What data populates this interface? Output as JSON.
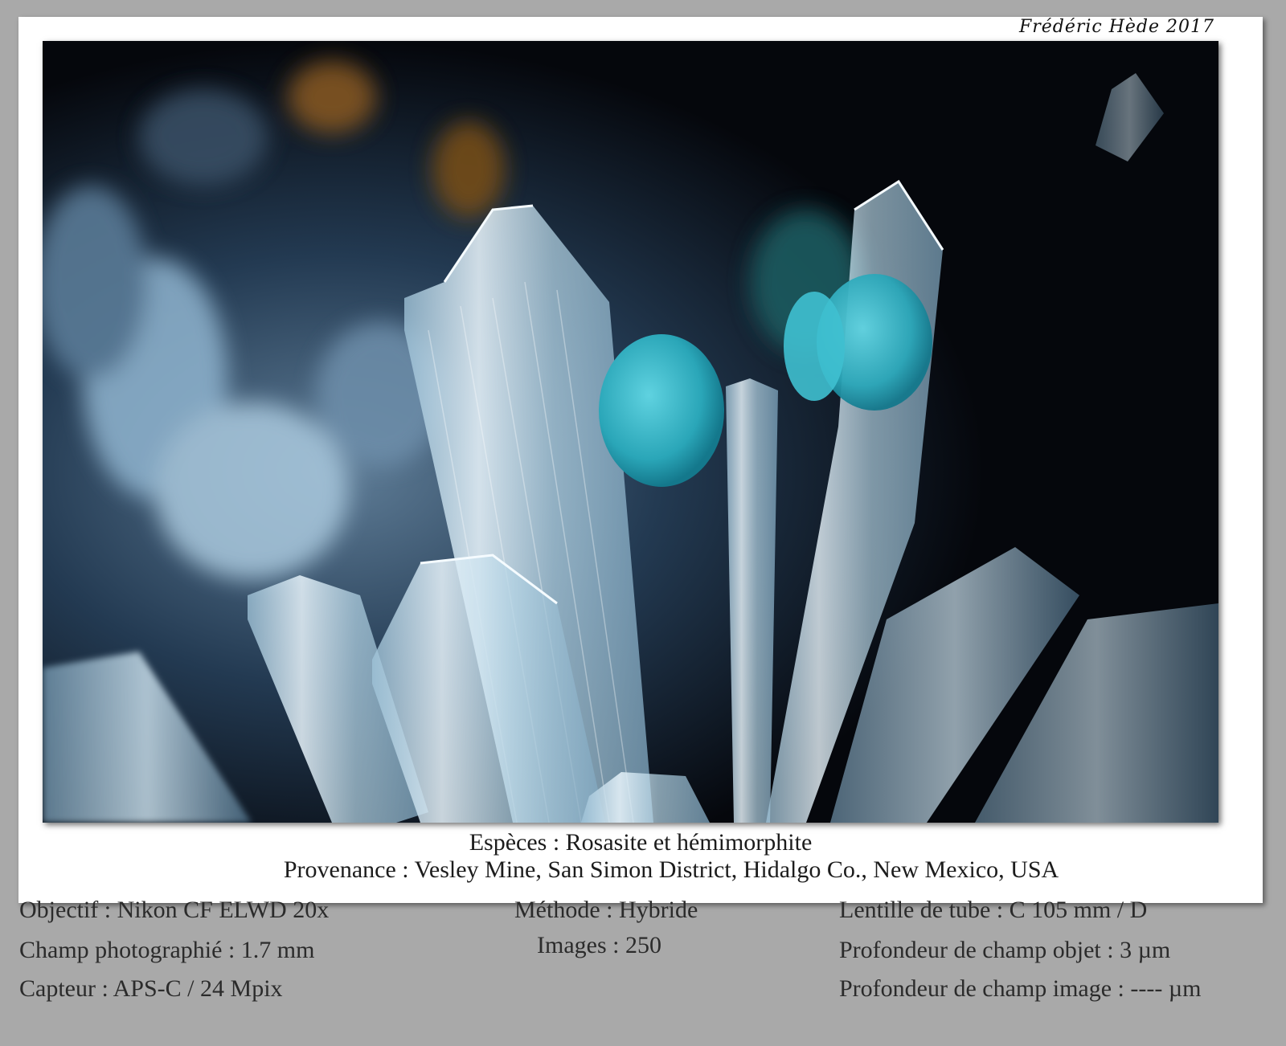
{
  "signature": "Frédéric Hède 2017",
  "caption": {
    "species": "Espèces : Rosasite et hémimorphite",
    "provenance": "Provenance : Vesley Mine, San Simon District, Hidalgo Co., New Mexico, USA"
  },
  "meta": {
    "objective": "Objectif : Nikon CF ELWD 20x",
    "field": "Champ photographié : 1.7 mm",
    "sensor": "Capteur : APS-C / 24 Mpix",
    "method": "Méthode : Hybride",
    "images": "Images : 250",
    "tube_lens": "Lentille de tube : C 105 mm / D",
    "dof_object": "Profondeur de champ objet : 3 µm",
    "dof_image": "Profondeur de champ image : ---- µm"
  },
  "colors": {
    "background": "#a9a9a9",
    "sheet": "#ffffff",
    "rosasite": "#2aa6b8",
    "crystal": "#cfe4f0"
  }
}
